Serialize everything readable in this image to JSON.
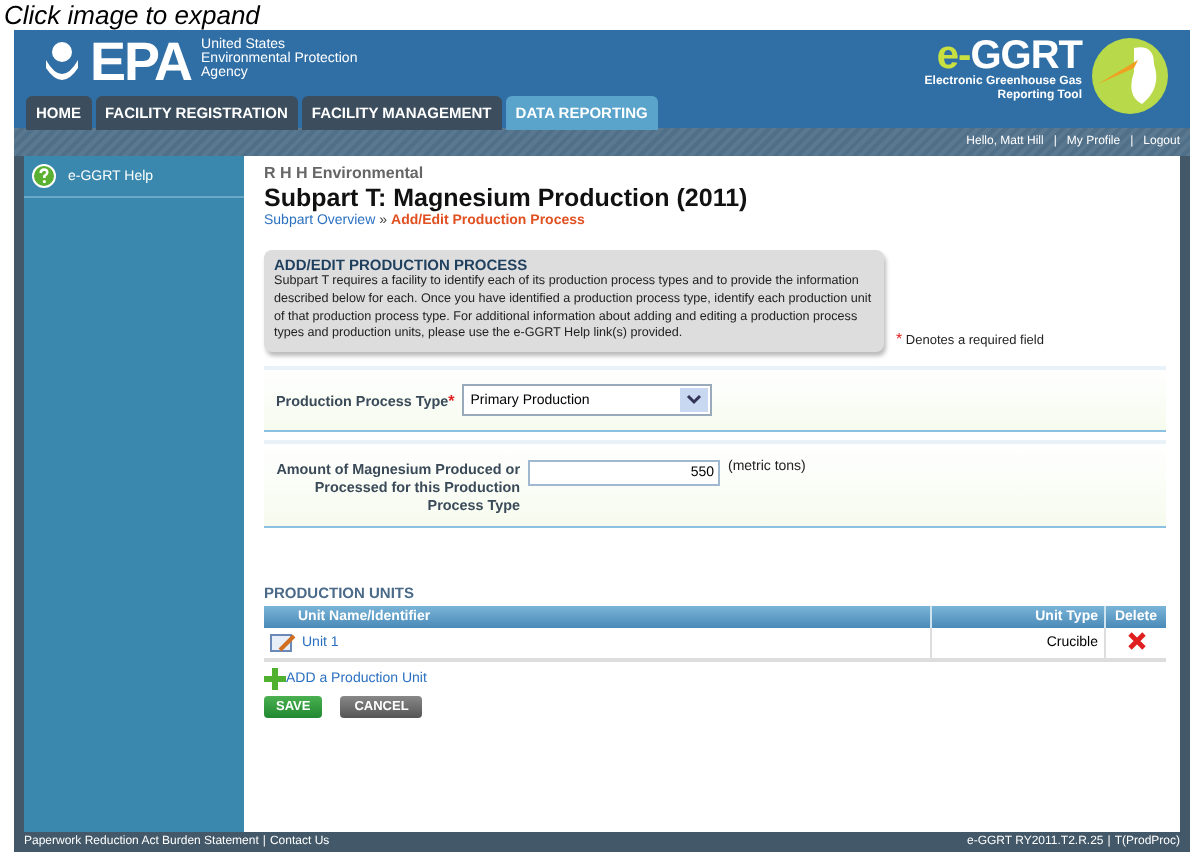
{
  "caption": "Click image to expand",
  "logo": "EPA",
  "agency": {
    "lines": [
      "United States",
      "Environmental Protection",
      "Agency"
    ]
  },
  "brand": {
    "name_prefix": "e-",
    "name": "GGRT",
    "subtitle_lines": [
      "Electronic Greenhouse Gas",
      "Reporting Tool"
    ]
  },
  "tabs": [
    {
      "label": "HOME",
      "selected": false
    },
    {
      "label": "FACILITY REGISTRATION",
      "selected": false
    },
    {
      "label": "FACILITY MANAGEMENT",
      "selected": false
    },
    {
      "label": "DATA REPORTING",
      "selected": true
    }
  ],
  "user_links": [
    "Hello, Matt Hill",
    "My Profile",
    "Logout"
  ],
  "separator": "|",
  "breadcrumb_separator": "»",
  "required_mark": "*",
  "sidebar": {
    "items": [
      "e-GGRT Help"
    ]
  },
  "facility": "R H H Environmental",
  "title": "Subpart T: Magnesium Production (2011)",
  "breadcrumb": [
    {
      "label": "Subpart Overview",
      "current": false
    },
    {
      "label": "Add/Edit Production Process",
      "current": true
    }
  ],
  "info_box": {
    "heading": "ADD/EDIT PRODUCTION PROCESS",
    "text": "Subpart T requires a facility to identify each of its production process types and to provide the information described below for each. Once you have identified a production process type, identify each production unit of that production process type. For additional information about adding and editing a production process types and production units, please use the e-GGRT Help link(s) provided."
  },
  "required_note": "Denotes a required field",
  "fields": [
    {
      "kind": "select",
      "label": "Production Process Type",
      "required": true,
      "value": "Primary Production"
    },
    {
      "kind": "number",
      "label": "Amount of Magnesium Produced or Processed for this Production Process Type",
      "required": false,
      "value": "550",
      "unit": "(metric tons)"
    }
  ],
  "units": {
    "heading": "PRODUCTION UNITS",
    "columns": [
      "Unit Name/Identifier",
      "Unit Type",
      "Delete"
    ],
    "rows": [
      {
        "name": "Unit 1",
        "type": "Crucible"
      }
    ],
    "add_link": "ADD a Production Unit"
  },
  "buttons": [
    {
      "label": "SAVE",
      "kind": "primary"
    },
    {
      "label": "CANCEL",
      "kind": "secondary"
    }
  ],
  "footer": {
    "left": [
      "Paperwork Reduction Act Burden Statement",
      "Contact Us"
    ],
    "right": [
      "e-GGRT RY2011.T2.R.25",
      "T(ProdProc)"
    ]
  }
}
